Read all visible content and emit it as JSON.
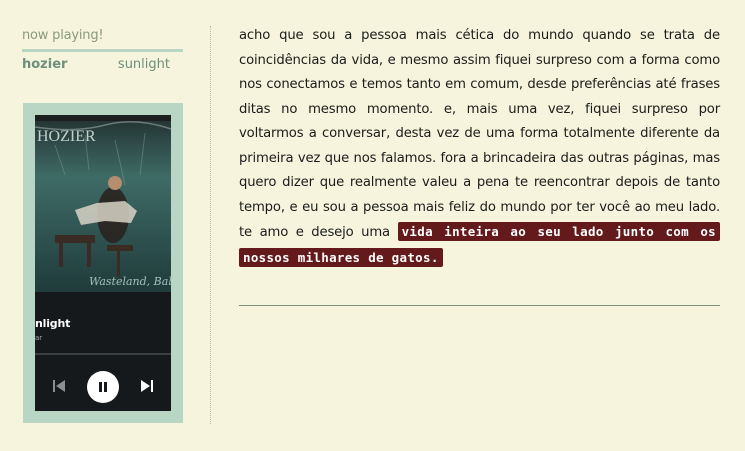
{
  "now_playing": {
    "label": "now playing!",
    "artist": "hozier",
    "song": "sunlight"
  },
  "player": {
    "album_art_text": "HOZIER",
    "album_script_text": "Wasteland, Baby!",
    "title": "nlight",
    "subtitle": "ar",
    "icons": [
      "previous-icon",
      "pause-icon",
      "next-icon"
    ]
  },
  "body_text": {
    "paragraph": "acho que sou a pessoa mais cética do mundo quando se trata de coincidências da vida, e mesmo assim fiquei surpreso com a forma como nos conectamos e temos tanto em comum, desde preferências até frases ditas no mesmo momento. e, mais uma vez, fiquei surpreso por voltarmos a conversar, desta vez de uma forma totalmente diferente da primeira vez que nos falamos. fora a brincadeira das outras páginas, mas quero dizer que realmente valeu a pena te reencontrar depois de tanto tempo, e eu sou a pessoa mais feliz do mundo por ter você ao meu lado. te amo e desejo uma",
    "highlight": "vida inteira ao seu lado junto com os nossos milhares de gatos."
  },
  "colors": {
    "background": "#f6f4dc",
    "accent_green": "#b9d6c4",
    "highlight_bg": "#64191b",
    "player_bg": "#15191b"
  }
}
